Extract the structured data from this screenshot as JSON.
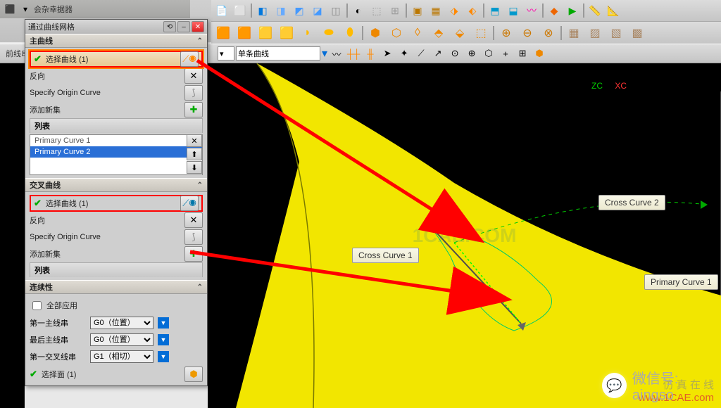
{
  "dialog": {
    "title": "通过曲线网格",
    "primary": {
      "header": "主曲线",
      "select_curve": "选择曲线 (1)",
      "reverse": "反向",
      "specify_origin": "Specify Origin Curve",
      "add_new_set": "添加新集",
      "list_header": "列表",
      "items": [
        "Primary Curve  1",
        "Primary Curve  2"
      ]
    },
    "cross": {
      "header": "交叉曲线",
      "select_curve": "选择曲线 (1)",
      "reverse": "反向",
      "specify_origin": "Specify Origin Curve",
      "add_new_set": "添加新集",
      "list_header": "列表"
    },
    "continuity": {
      "header": "连续性",
      "apply_all": "全部应用",
      "first_primary_label": "第一主线串",
      "first_primary_value": "G0（位置）",
      "last_primary_label": "最后主线串",
      "last_primary_value": "G0（位置）",
      "first_cross_label": "第一交叉线串",
      "first_cross_value": "G1（相切）",
      "select_face": "选择面 (1)"
    }
  },
  "selection_bar": {
    "left_fragment": "前线串",
    "rule": "单条曲线"
  },
  "viewport": {
    "axes": {
      "z": "ZC",
      "x": "XC"
    },
    "callouts": {
      "cross1": "Cross Curve  1",
      "cross2": "Cross Curve  2",
      "primary1": "Primary Curve  1"
    },
    "center_watermark": "1CAE.COM",
    "footer_line1": "仿 真 在 线",
    "footer_line2": "www.1CAE.com",
    "wechat": "微信号: aingso"
  }
}
